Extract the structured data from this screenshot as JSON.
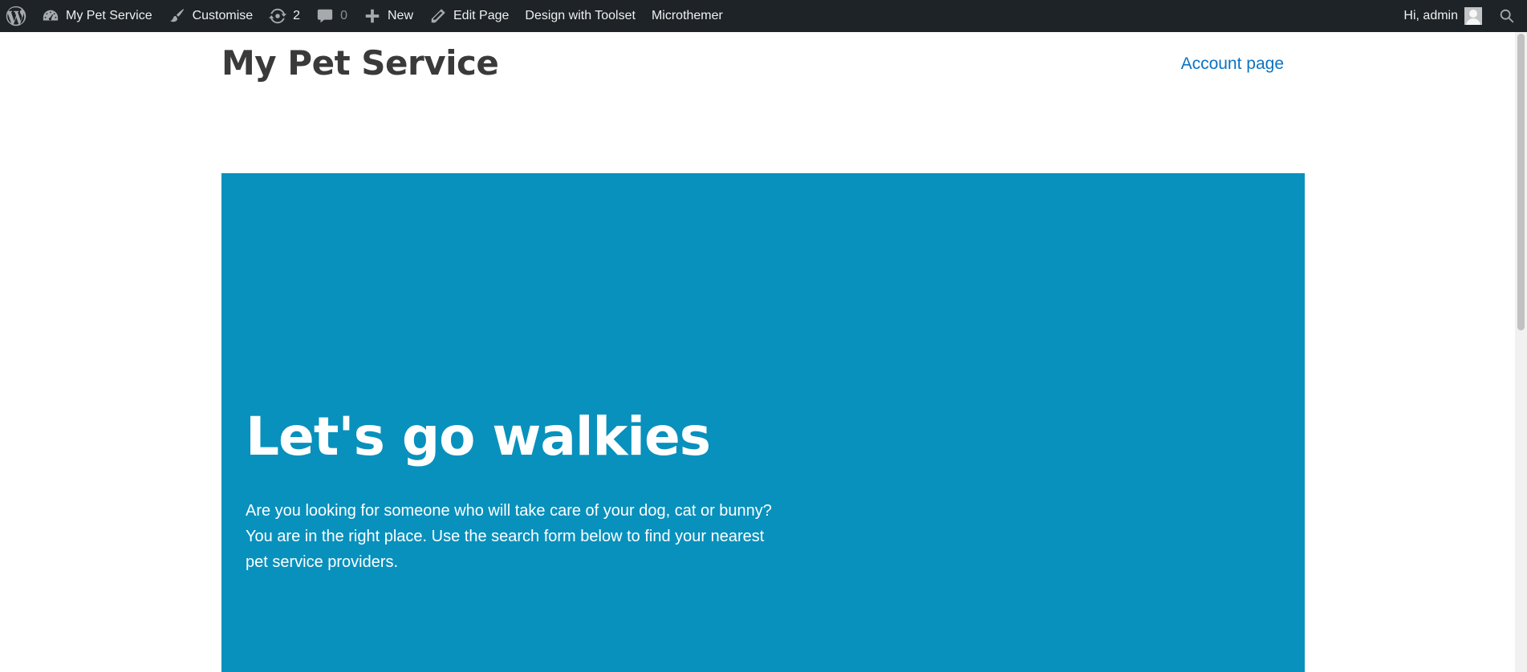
{
  "admin_bar": {
    "site_name": "My Pet Service",
    "customise": "Customise",
    "updates_count": "2",
    "comments_count": "0",
    "new_label": "New",
    "edit_page": "Edit Page",
    "design_with_toolset": "Design with Toolset",
    "microthemer": "Microthemer",
    "greeting": "Hi, admin",
    "icons": [
      "wordpress-logo-icon",
      "dashboard-icon",
      "brush-icon",
      "updates-icon",
      "comment-icon",
      "plus-icon",
      "pencil-icon",
      "search-icon"
    ]
  },
  "header": {
    "site_title": "My Pet Service",
    "nav": [
      {
        "label": "Account page"
      }
    ]
  },
  "hero": {
    "title": "Let's go walkies",
    "text": "Are you looking for someone who will take care of your dog, cat or bunny? You are in the right place. Use the search form below to find your nearest pet service providers."
  },
  "colors": {
    "admin_bar_bg": "#1d2327",
    "hero_bg": "#0891bd",
    "link": "#0d73c2",
    "site_title": "#3a3a3a"
  }
}
